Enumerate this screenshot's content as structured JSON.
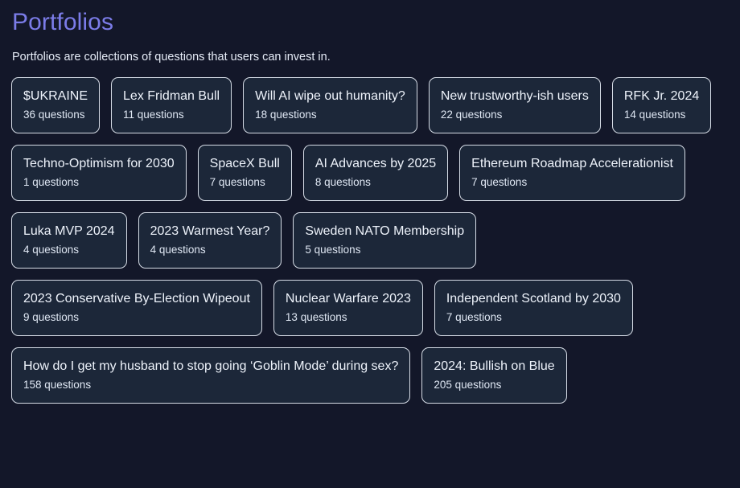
{
  "header": {
    "title": "Portfolios",
    "subtitle": "Portfolios are collections of questions that users can invest in."
  },
  "theme": {
    "background": "#131729",
    "card_background": "#1c2739",
    "card_border": "#d6dce6",
    "title_color": "#7b7ce8",
    "text_color": "#eef3fb"
  },
  "portfolios": [
    {
      "name": "$UKRAINE",
      "count": "36 questions"
    },
    {
      "name": "Lex Fridman Bull",
      "count": "11 questions"
    },
    {
      "name": "Will AI wipe out humanity?",
      "count": "18 questions"
    },
    {
      "name": "New trustworthy-ish users",
      "count": "22 questions"
    },
    {
      "name": "RFK Jr. 2024",
      "count": "14 questions"
    },
    {
      "name": "Techno-Optimism for 2030",
      "count": "1 questions"
    },
    {
      "name": "SpaceX Bull",
      "count": "7 questions"
    },
    {
      "name": "AI Advances by 2025",
      "count": "8 questions"
    },
    {
      "name": "Ethereum Roadmap Accelerationist",
      "count": "7 questions"
    },
    {
      "name": "Luka MVP 2024",
      "count": "4 questions"
    },
    {
      "name": "2023 Warmest Year?",
      "count": "4 questions"
    },
    {
      "name": "Sweden NATO Membership",
      "count": "5 questions"
    },
    {
      "name": "2023 Conservative By-Election Wipeout",
      "count": "9 questions"
    },
    {
      "name": "Nuclear Warfare 2023",
      "count": "13 questions"
    },
    {
      "name": "Independent Scotland by 2030",
      "count": "7 questions"
    },
    {
      "name": "How do I get my husband to stop going ‘Goblin Mode’ during sex?",
      "count": "158 questions"
    },
    {
      "name": "2024: Bullish on Blue",
      "count": "205 questions"
    }
  ]
}
